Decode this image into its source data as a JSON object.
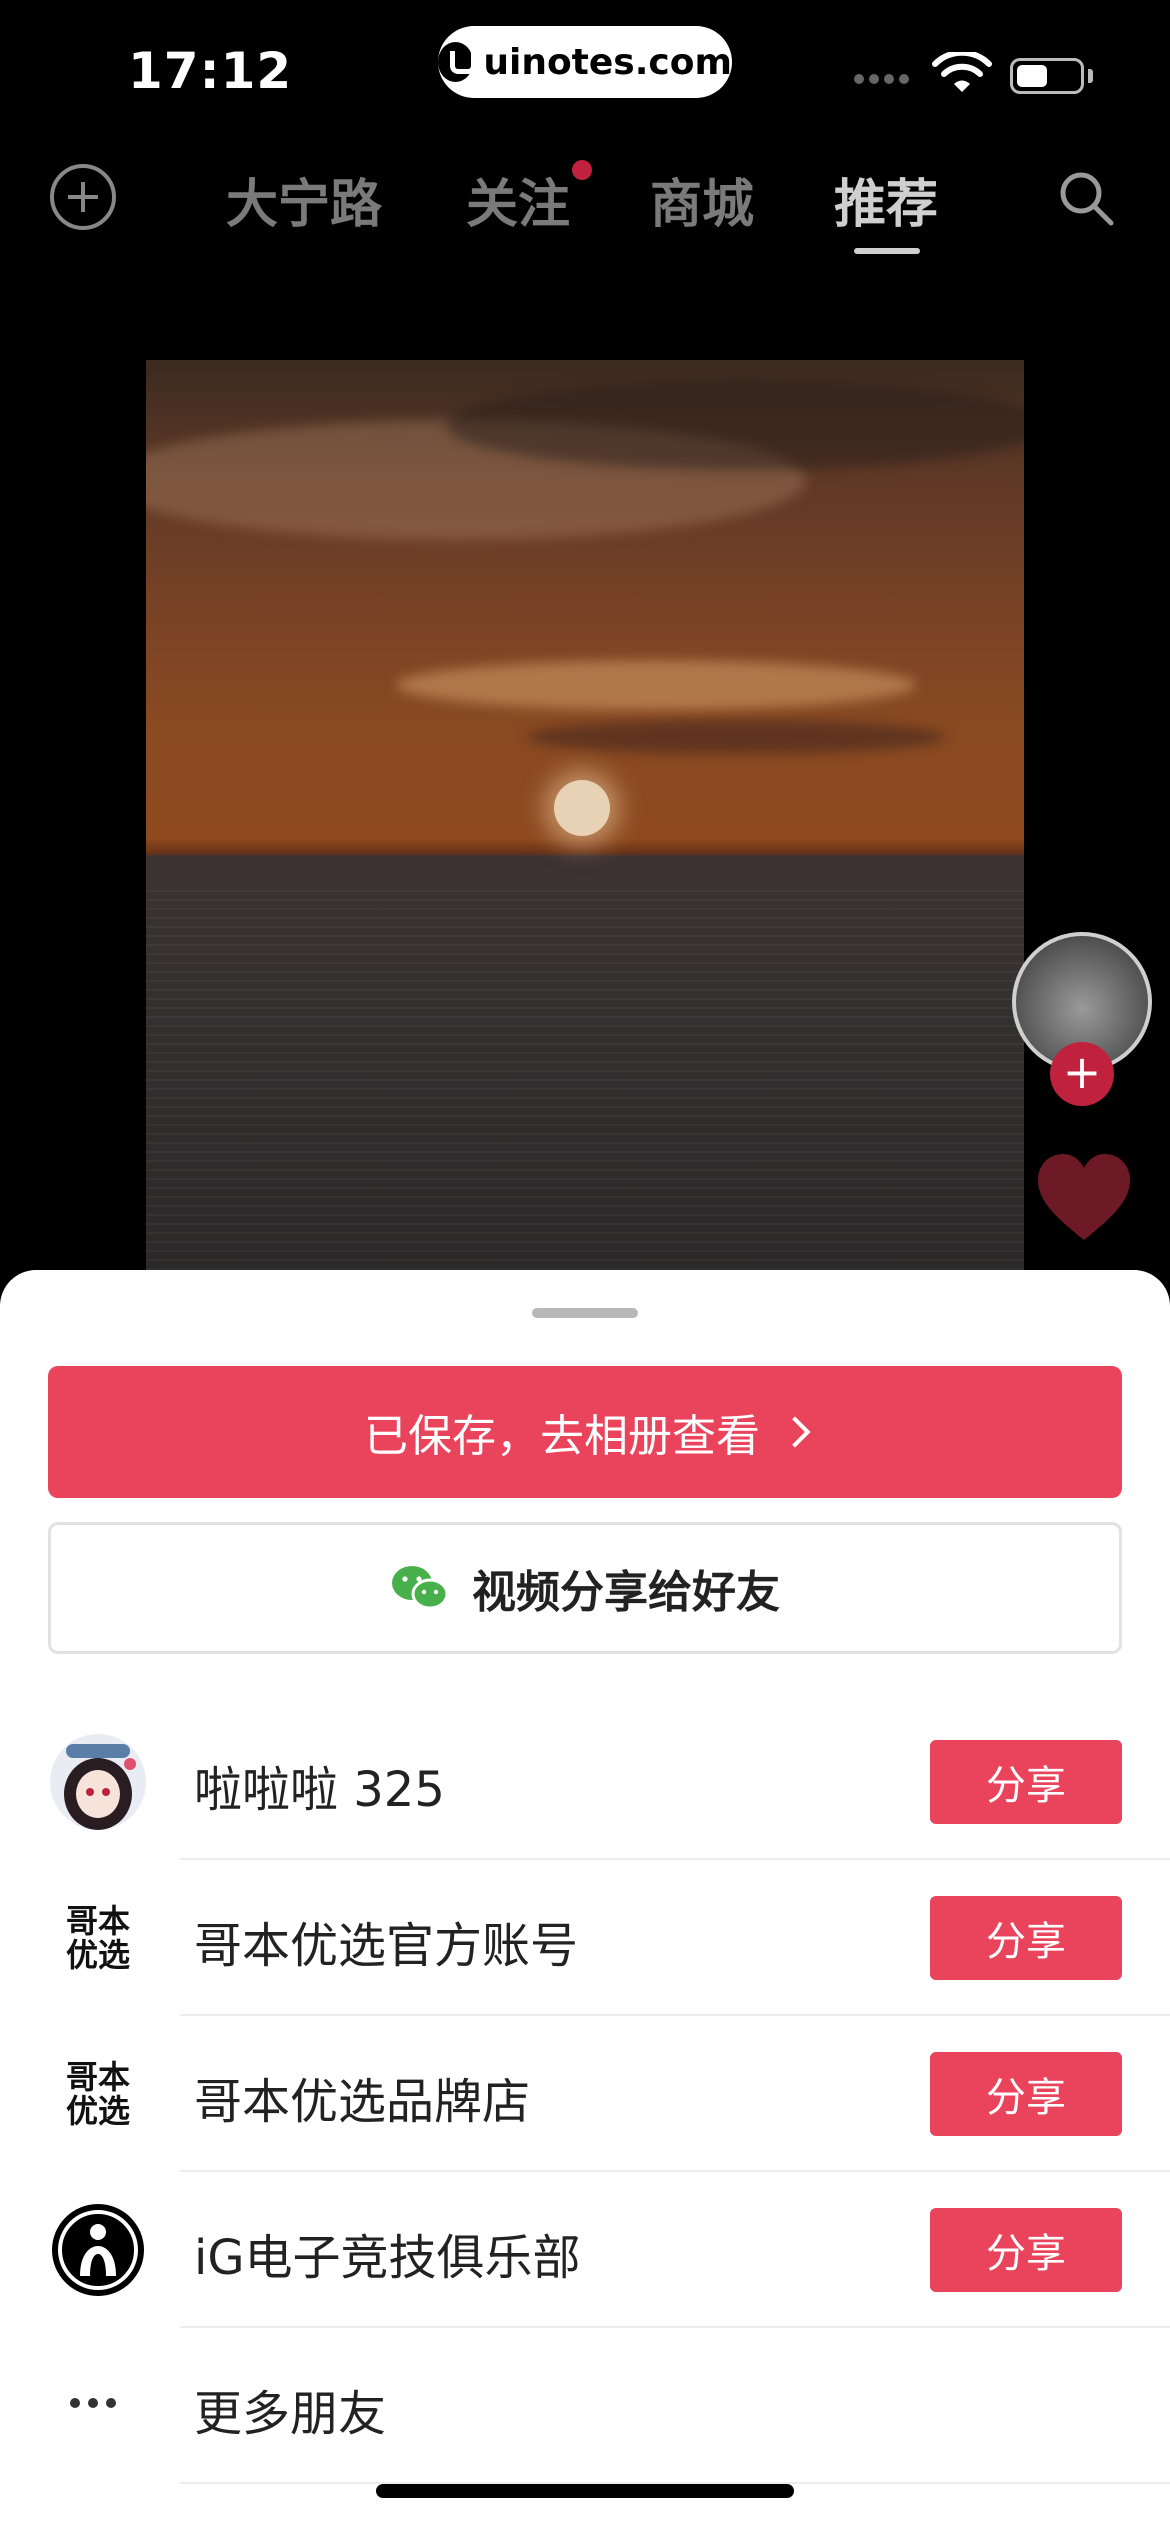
{
  "status_bar": {
    "time": "17:12",
    "site_badge": "uinotes.com"
  },
  "top_nav": {
    "tabs": [
      {
        "label": "大宁路",
        "active": false
      },
      {
        "label": "关注",
        "active": false,
        "has_dot": true
      },
      {
        "label": "商城",
        "active": false
      },
      {
        "label": "推荐",
        "active": true
      }
    ],
    "add_icon": "plus-circle-icon",
    "search_icon": "search-icon"
  },
  "right_rail": {
    "follow_symbol": "+",
    "like_icon": "heart-icon"
  },
  "share_sheet": {
    "saved_label": "已保存，去相册查看",
    "wechat_label": "视频分享给好友",
    "friends": [
      {
        "name": "啦啦啦 325",
        "share_label": "分享",
        "avatar": "anime-girl-avatar"
      },
      {
        "name": "哥本优选官方账号",
        "share_label": "分享",
        "logo_text": "哥本优选"
      },
      {
        "name": "哥本优选品牌店",
        "share_label": "分享",
        "logo_text": "哥本优选"
      },
      {
        "name": "iG电子竞技俱乐部",
        "share_label": "分享",
        "avatar": "ig-logo"
      }
    ],
    "more_label": "更多朋友"
  },
  "colors": {
    "accent": "#e9445c",
    "background": "#000000",
    "sheet": "#ffffff"
  }
}
